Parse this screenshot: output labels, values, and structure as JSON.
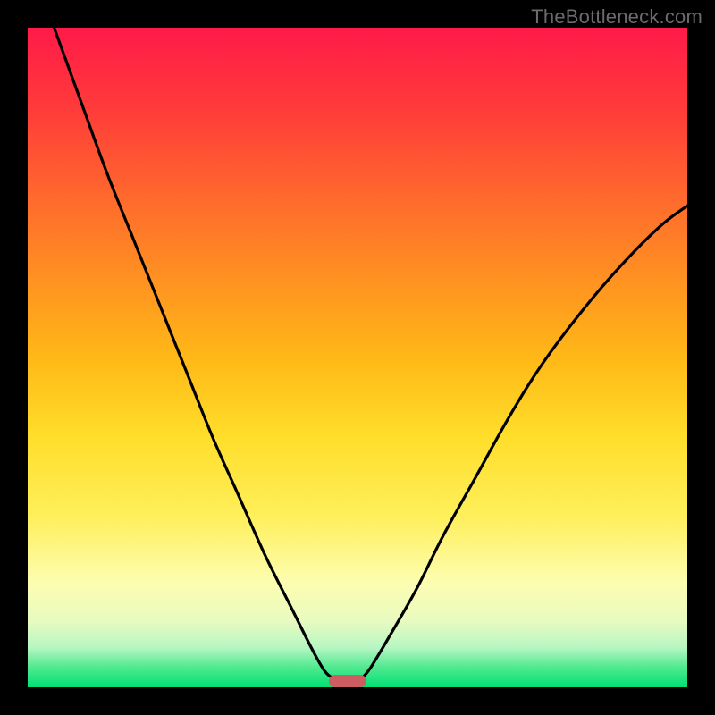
{
  "watermark": "TheBottleneck.com",
  "colors": {
    "frame": "#000000",
    "curve": "#000000",
    "marker": "#cd5d61",
    "gradient_top": "#ff1a49",
    "gradient_bottom": "#00e174"
  },
  "chart_data": {
    "type": "line",
    "title": "",
    "xlabel": "",
    "ylabel": "",
    "xlim": [
      0,
      100
    ],
    "ylim": [
      0,
      100
    ],
    "grid": false,
    "legend": false,
    "series": [
      {
        "name": "left-curve",
        "x": [
          4,
          8,
          12,
          16,
          20,
          24,
          28,
          32,
          36,
          40,
          43,
          45,
          46.5
        ],
        "y": [
          100,
          89,
          78,
          68,
          58,
          48,
          38,
          29,
          20,
          12,
          6,
          2.5,
          1.2
        ]
      },
      {
        "name": "right-curve",
        "x": [
          50.5,
          52,
          55,
          59,
          63,
          68,
          73,
          78,
          84,
          90,
          96,
          100
        ],
        "y": [
          1.2,
          3,
          8,
          15,
          23,
          32,
          41,
          49,
          57,
          64,
          70,
          73
        ]
      }
    ],
    "marker": {
      "x_center": 48.5,
      "y": 1.0,
      "width_pct": 5.7
    },
    "notes": "Axes are unlabeled; values are percent of plot width/height estimated from pixel positions. Curves depict two monotone branches meeting near the bottom at the marker."
  }
}
